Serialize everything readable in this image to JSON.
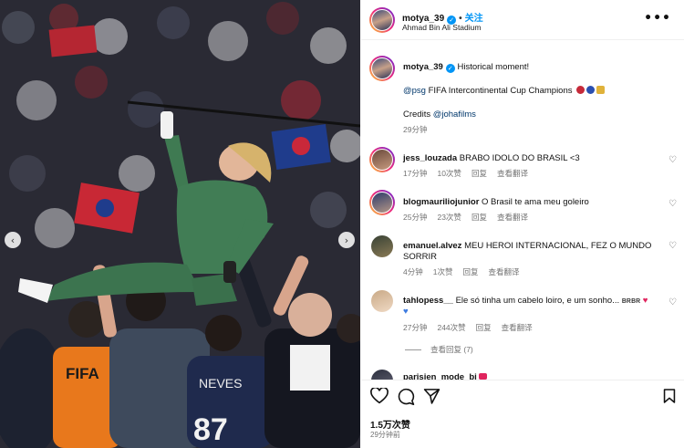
{
  "post": {
    "username": "motya_39",
    "follow_label": "关注",
    "location": "Ahmad Bin Ali Stadium",
    "more_label": "•••"
  },
  "caption": {
    "username": "motya_39",
    "line1": "Historical moment!",
    "mention": "@psg",
    "line2": "FIFA Intercontinental Cup Champions",
    "credits_prefix": "Credits",
    "credits_mention": "@johafilms",
    "time": "29分钟"
  },
  "comments": [
    {
      "username": "jess_louzada",
      "text": "BRABO IDOLO DO BRASIL <3",
      "time": "17分钟",
      "likes": "10次赞",
      "reply": "回复",
      "translate": "查看翻译"
    },
    {
      "username": "blogmauriliojunior",
      "text": "O Brasil te ama meu goleiro",
      "time": "25分钟",
      "likes": "23次赞",
      "reply": "回复",
      "translate": "查看翻译"
    },
    {
      "username": "emanuel.alvez",
      "text": "MEU HEROI INTERNACIONAL, FEZ O MUNDO SORRIR",
      "time": "4分钟",
      "likes": "1次赞",
      "reply": "回复",
      "translate": "查看翻译"
    },
    {
      "username": "tahlopess__",
      "text": "Ele só tinha um cabelo loiro, e um sonho... ʙʀʙʀ",
      "time": "27分钟",
      "likes": "244次赞",
      "reply": "回复",
      "translate": "查看翻译"
    },
    {
      "username": "parisien_mode_bj",
      "text": "",
      "time": "",
      "likes": "",
      "reply": "",
      "translate": ""
    }
  ],
  "view_replies": "查看回复 (7)",
  "likes_count": "1.5万次赞",
  "post_time": "29分钟前",
  "media": {
    "jersey_name": "NEVES",
    "jersey_number": "87",
    "vest_text": "FIFA"
  },
  "icons": {
    "nav_left": "‹",
    "nav_right": "›",
    "heart": "♡"
  },
  "colors": {
    "accent": "#0095f6",
    "keeper_green": "#3f7a52"
  }
}
